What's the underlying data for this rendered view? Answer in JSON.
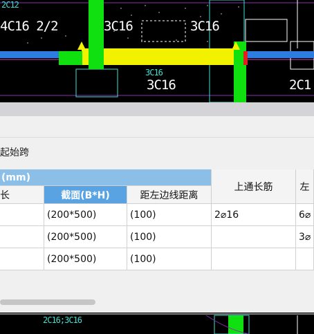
{
  "cad": {
    "labels_top": [
      "4C16 2/2",
      "3C16",
      "3C16",
      "3C16",
      "2C1"
    ],
    "labels_small": [
      "2C12",
      "3C16",
      "2C16;3C16"
    ]
  },
  "panel": {
    "start_span_label": "起始跨",
    "group_header": "(mm)",
    "columns": [
      "长",
      "截面(B*H)",
      "距左边线距离",
      "上通长筋",
      "左"
    ],
    "rows": [
      {
        "section": "(200*500)",
        "distance": "(100)",
        "top_bar": "2⌀16",
        "left_bar": "6⌀"
      },
      {
        "section": "(200*500)",
        "distance": "(100)",
        "top_bar": "",
        "left_bar": "3⌀"
      },
      {
        "section": "(200*500)",
        "distance": "(100)",
        "top_bar": "",
        "left_bar": ""
      }
    ]
  }
}
